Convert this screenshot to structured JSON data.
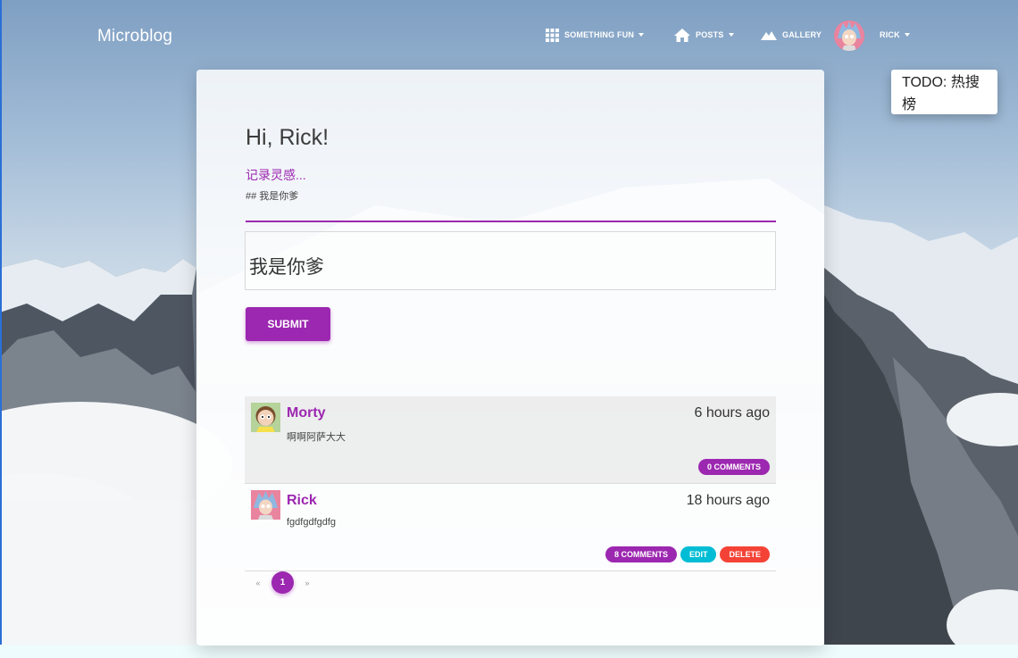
{
  "navbar": {
    "brand": "Microblog",
    "items": [
      {
        "label": "SOMETHING FUN",
        "icon": "grid-icon"
      },
      {
        "label": "POSTS",
        "icon": "home-icon"
      },
      {
        "label": "GALLERY",
        "icon": "mountain-icon"
      },
      {
        "label": "RICK",
        "icon": "user-avatar"
      }
    ]
  },
  "todo_popup": {
    "text": "TODO: 热搜榜"
  },
  "compose": {
    "greeting": "Hi, Rick!",
    "field_label": "记录灵感...",
    "field_value": "## 我是你爹",
    "preview": "我是你爹",
    "submit_label": "SUBMIT"
  },
  "posts": [
    {
      "author": "Morty",
      "time": "6 hours ago",
      "body": "啊啊阿萨大大",
      "comments_label": "0 COMMENTS"
    },
    {
      "author": "Rick",
      "time": "18 hours ago",
      "body": "fgdfgdfgdfg",
      "comments_label": "8 COMMENTS",
      "edit_label": "EDIT",
      "delete_label": "DELETE"
    }
  ],
  "pagination": {
    "prev": "«",
    "current": "1",
    "next": "»"
  },
  "colors": {
    "accent": "#9c27b0",
    "info": "#00bcd4",
    "danger": "#f44336"
  }
}
